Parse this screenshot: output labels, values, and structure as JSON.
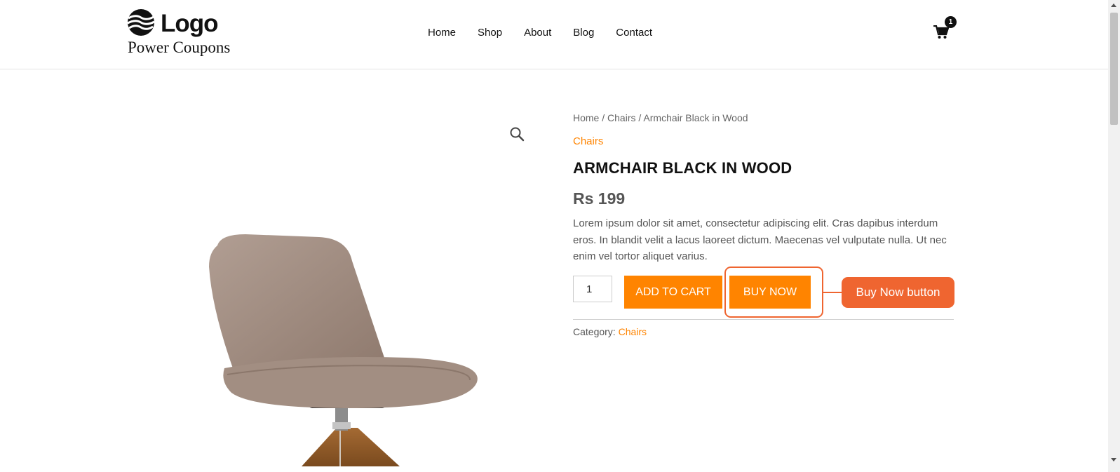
{
  "header": {
    "logo_text": "Logo",
    "logo_subtitle": "Power Coupons",
    "nav": [
      {
        "label": "Home"
      },
      {
        "label": "Shop"
      },
      {
        "label": "About"
      },
      {
        "label": "Blog"
      },
      {
        "label": "Contact"
      }
    ],
    "cart_icon": "cart-icon",
    "cart_count": "1"
  },
  "product": {
    "breadcrumb": {
      "home": "Home",
      "sep": " / ",
      "category": "Chairs",
      "current": "Armchair Black in Wood"
    },
    "category": "Chairs",
    "title": "ARMCHAIR BLACK IN WOOD",
    "price": "Rs 199",
    "description": "Lorem ipsum dolor sit amet, consectetur adipiscing elit. Cras dapibus interdum eros. In blandit velit a lacus laoreet dictum. Maecenas vel vulputate nulla. Ut nec enim vel tortor aliquet varius.",
    "quantity": "1",
    "add_to_cart_label": "ADD TO CART",
    "buy_now_label": "BUY NOW",
    "meta_label": "Category: ",
    "meta_category": "Chairs",
    "zoom_icon": "magnifier-icon"
  },
  "annotation": {
    "callout_label": "Buy Now button"
  },
  "colors": {
    "accent": "#ff8400",
    "annotation": "#ef6530"
  }
}
